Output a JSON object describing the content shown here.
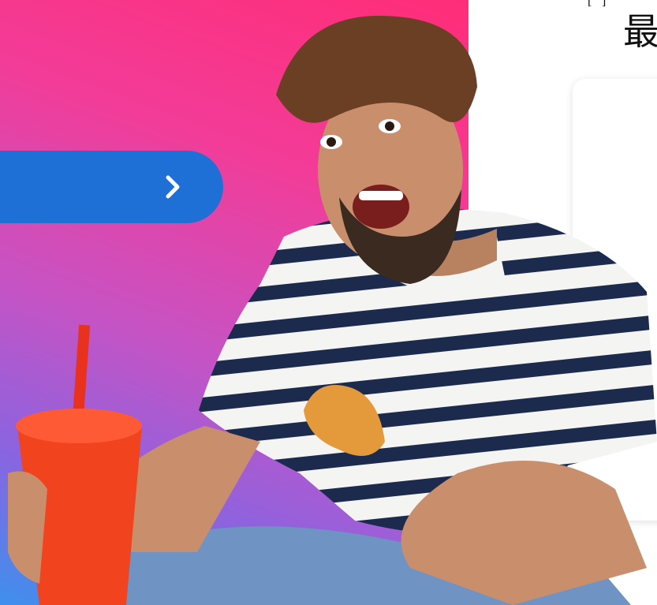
{
  "header": {
    "top_fragment": "[ ]",
    "heading_fragment": "最"
  },
  "cta": {
    "icon": "chevron-right-icon"
  },
  "hero": {
    "image": "smiling-man-with-fried-chicken-and-drink",
    "colors": {
      "gradient_pink": "#ff2d78",
      "gradient_purple": "#c653c4",
      "gradient_blue": "#3e90ee",
      "button_blue": "#1e6fd6"
    }
  }
}
